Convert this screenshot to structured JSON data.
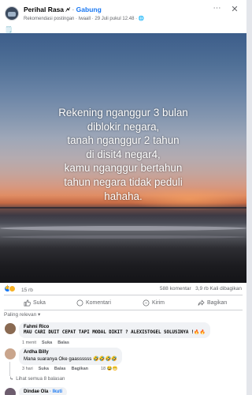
{
  "post": {
    "page_name": "Perihal Rasa",
    "verified_mark": "🗲",
    "separator": "·",
    "join_label": "Gabung",
    "meta": "Rekomendasi postingan · Iwaall · 29 Juli pukul 12.48 · 🌐",
    "more_icon": "⋯",
    "close_icon": "✕",
    "caption": "🗒️"
  },
  "image_text": [
    "Rekening nganggur 3 bulan",
    "diblokir negara,",
    "tanah nganggur 2 tahun",
    "di disit4 negar4,",
    "kamu nganggur bertahun",
    "tahun negara tidak peduli",
    "hahaha."
  ],
  "stats": {
    "reactions": "15 rb",
    "comments": "588 komentar",
    "shares": "3,9 rb Kali dibagikan"
  },
  "actions": {
    "like": "Suka",
    "comment": "Komentari",
    "send": "Kirim",
    "share": "Bagikan"
  },
  "comments_section": {
    "sort_label": "Paling relevan ▾",
    "see_more": "Lihat semua 8 balasan"
  },
  "comments": [
    {
      "name": "Fahmi Rico",
      "text": "MAU CARI DUIT CEPAT TAPI MODAL DIKIT ? ALEXISTOGEL SOLUSINYA !🔥🔥",
      "time": "1 menit",
      "like": "Suka",
      "reply": "Balas"
    },
    {
      "name": "Ardha Billy",
      "text": "Mana suaranya Oke gaassssss 🤣🤣🤣🤣",
      "time": "3 hari",
      "like": "Suka",
      "reply": "Balas",
      "share": "Bagikan",
      "count": "18 😂😁"
    },
    {
      "name": "Dindae Ola",
      "follow": "· Ikuti"
    }
  ],
  "colors": {
    "accent": "#1877f2",
    "muted": "#65676b",
    "bubble": "#f0f2f5"
  }
}
